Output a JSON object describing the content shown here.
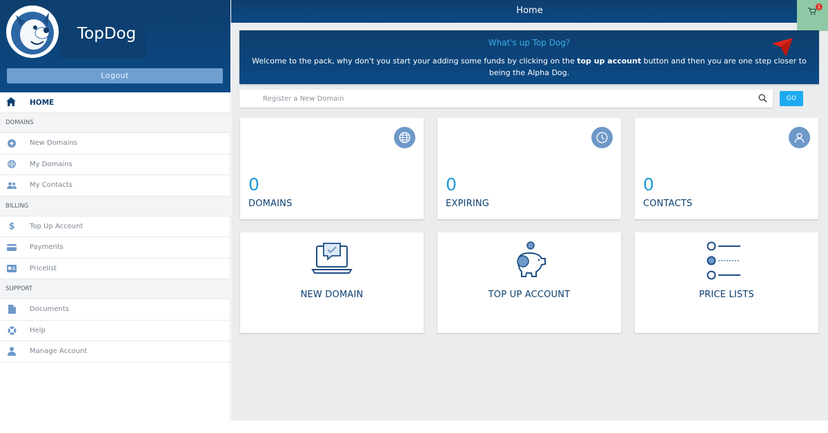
{
  "brand": {
    "name": "TopDog"
  },
  "sidebar": {
    "logout_label": "Logout",
    "home_label": "HOME",
    "sections": {
      "domains": "DOMAINS",
      "billing": "BILLING",
      "support": "SUPPORT"
    },
    "items": {
      "new_domains": "New Domains",
      "my_domains": "My Domains",
      "my_contacts": "My Contacts",
      "top_up_account": "Top Up Account",
      "payments": "Payments",
      "pricelist": "Pricelist",
      "documents": "Documents",
      "help": "Help",
      "manage_account": "Manage Account"
    }
  },
  "header": {
    "title": "Home",
    "cart_count": "1"
  },
  "banner": {
    "title": "What's up Top Dog?",
    "text_before": "Welcome to the pack, why don't you start your adding some funds by clicking on the ",
    "text_bold": "top up account",
    "text_after": " button and then you are one step closer to being the Alpha Dog."
  },
  "search": {
    "placeholder": "Register a New Domain",
    "go_label": "GO"
  },
  "stats": {
    "domains": {
      "value": "0",
      "label": "DOMAINS"
    },
    "expiring": {
      "value": "0",
      "label": "EXPIRING"
    },
    "contacts": {
      "value": "0",
      "label": "CONTACTS"
    }
  },
  "actions": {
    "new_domain": "NEW DOMAIN",
    "top_up_account": "TOP UP ACCOUNT",
    "price_lists": "PRICE LISTS"
  },
  "colors": {
    "navy": "#0d3f70",
    "accent_blue": "#1eaaf1",
    "icon_blue": "#6d98c8",
    "cart_green": "#8fc9a6",
    "arrow_red": "#e0241b"
  }
}
